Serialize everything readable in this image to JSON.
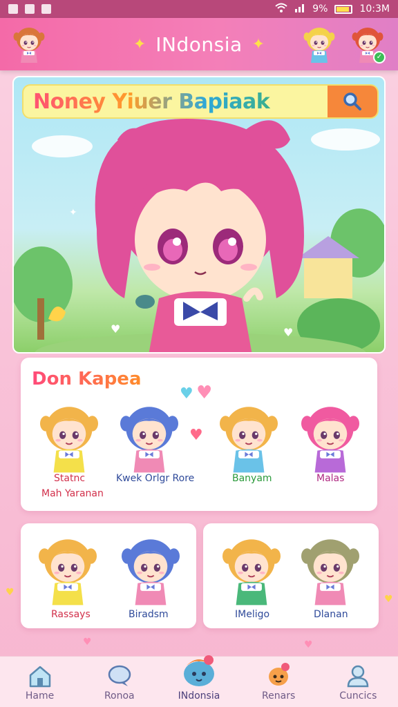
{
  "status_bar": {
    "battery_text": "9%",
    "time": "10:3M"
  },
  "header": {
    "title": "INdonsia",
    "avatars": [
      "profile-avatar-girl",
      "friend-avatar-blonde",
      "friend-avatar-redhead"
    ]
  },
  "search": {
    "text": "Noney Yiuer Bapiaak",
    "button_icon": "search-icon"
  },
  "featured_card": {
    "title": "Don Kapea",
    "characters": [
      {
        "label_line1": "Statnc",
        "label_line2": "Mah Yaranan",
        "label_color": "#d2304b"
      },
      {
        "label_line1": "Kwek Orlgr Rore",
        "label_line2": "",
        "label_color": "#2f4a9a"
      },
      {
        "label_line1": "Banyam",
        "label_color": "#2a9a3a"
      },
      {
        "label_line1": "Malas",
        "label_color": "#b02a82"
      }
    ]
  },
  "card_left": {
    "characters": [
      {
        "label": "Rassays",
        "label_color": "#d2304b"
      },
      {
        "label": "Biradsm",
        "label_color": "#2f4a9a"
      }
    ]
  },
  "card_right": {
    "characters": [
      {
        "label": "IMeligo",
        "label_color": "#2f4a9a"
      },
      {
        "label": "Dlanan",
        "label_color": "#2f4a9a"
      }
    ]
  },
  "bottom_nav": [
    {
      "label": "Hame",
      "icon": "home-icon"
    },
    {
      "label": "Ronoa",
      "icon": "chat-bubble-icon"
    },
    {
      "label": "INdonsia",
      "icon": "mascot-icon",
      "active": true
    },
    {
      "label": "Renars",
      "icon": "character-icon"
    },
    {
      "label": "Cuncics",
      "icon": "profile-icon"
    }
  ],
  "colors": {
    "header": "#f46aa8",
    "accent_orange": "#f6873a",
    "search_bg": "#fbf5a0",
    "nav_bg": "#fde6ee"
  }
}
